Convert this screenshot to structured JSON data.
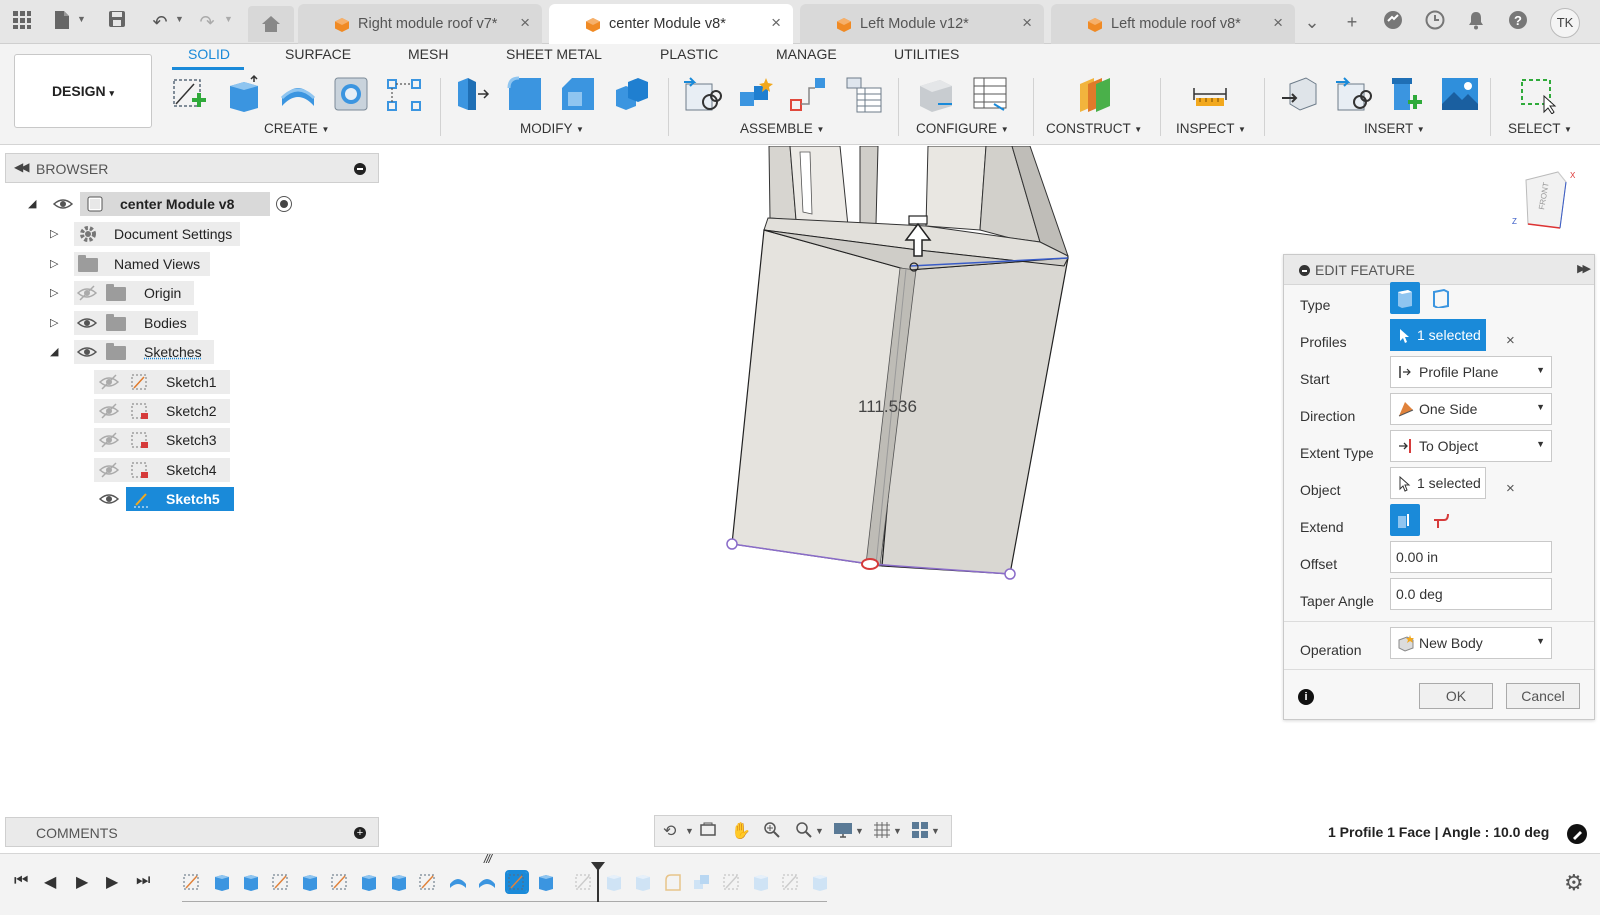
{
  "tabs": [
    {
      "label": "Right module roof v7*",
      "close": "×",
      "active": false
    },
    {
      "label": "center Module v8*",
      "close": "×",
      "active": true
    },
    {
      "label": "Left Module v12*",
      "close": "×",
      "active": false
    },
    {
      "label": "Left module roof v8*",
      "close": "×",
      "active": false
    }
  ],
  "user_initials": "TK",
  "workspace": {
    "label": "DESIGN",
    "caret": "▾"
  },
  "ribbon_tabs": [
    "SOLID",
    "SURFACE",
    "MESH",
    "SHEET METAL",
    "PLASTIC",
    "MANAGE",
    "UTILITIES"
  ],
  "ribbon_groups": [
    "CREATE",
    "MODIFY",
    "ASSEMBLE",
    "CONFIGURE",
    "CONSTRUCT",
    "INSPECT",
    "INSERT",
    "SELECT"
  ],
  "browser": {
    "title": "BROWSER",
    "root": "center Module v8",
    "items": [
      {
        "label": "Document Settings"
      },
      {
        "label": "Named Views"
      },
      {
        "label": "Origin"
      },
      {
        "label": "Bodies"
      },
      {
        "label": "Sketches"
      }
    ],
    "sketches": [
      "Sketch1",
      "Sketch2",
      "Sketch3",
      "Sketch4",
      "Sketch5"
    ]
  },
  "viewport": {
    "dimension_label": "111.536",
    "viewcube_label": "FRONT"
  },
  "edit_feature": {
    "title": "EDIT FEATURE",
    "type_label": "Type",
    "profiles_label": "Profiles",
    "profiles_value": "1 selected",
    "start_label": "Start",
    "start_value": "Profile Plane",
    "direction_label": "Direction",
    "direction_value": "One Side",
    "extent_type_label": "Extent Type",
    "extent_type_value": "To Object",
    "object_label": "Object",
    "object_value": "1 selected",
    "extend_label": "Extend",
    "offset_label": "Offset",
    "offset_value": "0.00 in",
    "taper_label": "Taper Angle",
    "taper_value": "0.0 deg",
    "operation_label": "Operation",
    "operation_value": "New Body",
    "clear": "×",
    "ok": "OK",
    "cancel": "Cancel"
  },
  "comments": {
    "title": "COMMENTS"
  },
  "status_text": "1 Profile 1 Face | Angle : 10.0 deg",
  "colors": {
    "accent": "#1a8ad9",
    "tab_cube": "#f08a24",
    "model_face": "#e8e6e1",
    "sketch_line": "#8a6cc9"
  }
}
